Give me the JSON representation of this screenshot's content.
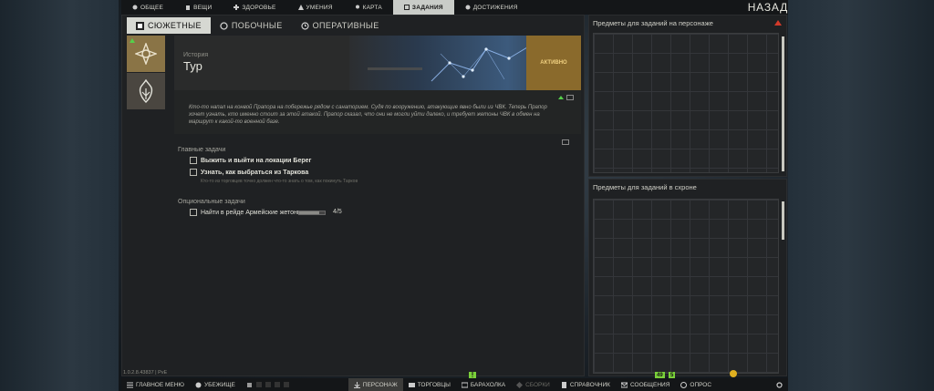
{
  "topnav": {
    "tabs": [
      {
        "label": "ОБЩЕЕ",
        "icon": "info-icon"
      },
      {
        "label": "ВЕЩИ",
        "icon": "backpack-icon"
      },
      {
        "label": "ЗДОРОВЬЕ",
        "icon": "health-icon"
      },
      {
        "label": "УМЕНИЯ",
        "icon": "skills-icon"
      },
      {
        "label": "КАРТА",
        "icon": "map-pin-icon"
      },
      {
        "label": "ЗАДАНИЯ",
        "icon": "tasks-icon",
        "active": true
      },
      {
        "label": "ДОСТИЖЕНИЯ",
        "icon": "achievements-icon"
      }
    ],
    "back_label": "НАЗАД"
  },
  "subtabs": [
    {
      "label": "СЮЖЕТНЫЕ",
      "icon": "story-icon",
      "active": true
    },
    {
      "label": "ПОБОЧНЫЕ",
      "icon": "side-quest-icon"
    },
    {
      "label": "ОПЕРАТИВНЫЕ",
      "icon": "clock-icon"
    }
  ],
  "quest": {
    "category": "История",
    "title": "Тур",
    "status": "АКТИВНО",
    "description": "Кто-то напал на конвой Прапора на побережье рядом с санаторием. Судя по вооружению, атакующие явно были из ЧВК. Теперь Прапор хочет узнать, кто именно стоит за этой атакой. Прапор сказал, что они не могли уйти далеко, и требует жетоны ЧВК в обмен на маршрут к какой-то военной базе.",
    "main_tasks_label": "Главные задачи",
    "main_tasks": [
      {
        "label": "Выжить и выйти на локации Берег"
      },
      {
        "label": "Узнать, как выбраться из Таркова",
        "hint": "Кто-то из торговцев точно должен что-то знать о том, как покинуть Тарков"
      }
    ],
    "optional_tasks_label": "Опциональные задачи",
    "optional_tasks": [
      {
        "label": "Найти в рейде Армейские жетоны",
        "progress_text": "4/5",
        "progress": 0.8
      }
    ]
  },
  "right_panels": {
    "character": {
      "title": "Предметы для заданий на персонаже"
    },
    "stash": {
      "title": "Предметы для заданий в схроне"
    }
  },
  "bottombar": {
    "version": "1.0.2.8.43837 | PvE",
    "items": [
      {
        "label": "ГЛАВНОЕ МЕНЮ",
        "icon": "menu-icon"
      },
      {
        "label": "УБЕЖИЩЕ",
        "icon": "hideout-icon"
      },
      {
        "label": "ПЕРСОНАЖ",
        "icon": "character-icon",
        "active": true
      },
      {
        "label": "ТОРГОВЦЫ",
        "icon": "traders-icon"
      },
      {
        "label": "БАРАХОЛКА",
        "icon": "flea-market-icon"
      },
      {
        "label": "СБОРКИ",
        "icon": "builds-icon",
        "dim": true
      },
      {
        "label": "СПРАВОЧНИК",
        "icon": "handbook-icon"
      },
      {
        "label": "СООБЩЕНИЯ",
        "icon": "messages-icon"
      },
      {
        "label": "ОПРОС",
        "icon": "survey-icon"
      }
    ],
    "badges": {
      "left": "49",
      "right": "5"
    }
  },
  "colors": {
    "accent_green": "#7ad03a",
    "status_orange": "#8a6a2c",
    "warning_red": "#d23a2a"
  }
}
